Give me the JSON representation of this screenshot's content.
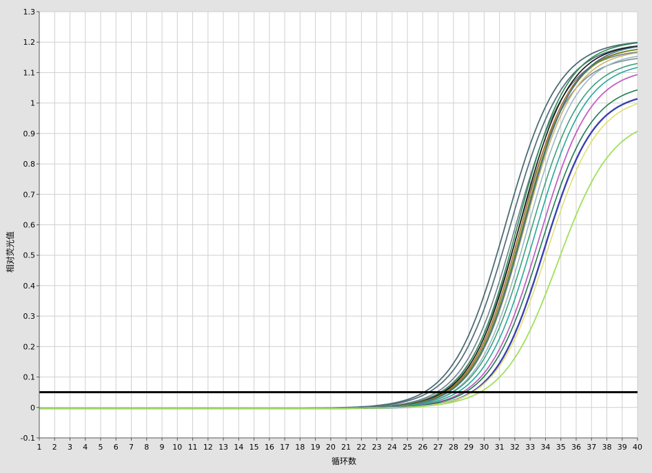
{
  "chart_data": {
    "type": "line",
    "title": "",
    "xlabel": "循环数",
    "ylabel": "相对荧光值",
    "xlim": [
      1,
      40
    ],
    "ylim": [
      -0.1,
      1.3
    ],
    "grid": true,
    "legend": "none",
    "x_ticks": [
      1,
      2,
      3,
      4,
      5,
      6,
      7,
      8,
      9,
      10,
      11,
      12,
      13,
      14,
      15,
      16,
      17,
      18,
      19,
      20,
      21,
      22,
      23,
      24,
      25,
      26,
      27,
      28,
      29,
      30,
      31,
      32,
      33,
      34,
      35,
      36,
      37,
      38,
      39,
      40
    ],
    "y_ticks": [
      -0.1,
      0,
      0.1,
      0.2,
      0.3,
      0.4,
      0.5,
      0.6,
      0.7,
      0.8,
      0.9,
      1,
      1.1,
      1.2,
      1.3
    ],
    "y_tick_labels": [
      "-0.1",
      "0",
      "0.1",
      "0.2",
      "0.3",
      "0.4",
      "0.5",
      "0.6",
      "0.7",
      "0.8",
      "0.9",
      "1",
      "1.1",
      "1.2",
      "1.3"
    ],
    "threshold": 0.05,
    "threshold_color": "#000000",
    "baseline": -0.003,
    "plot_background": "#ffffff",
    "grid_color": "#cfcfcf",
    "series": [
      {
        "color": "#4a6a72",
        "width": 1.8,
        "plateau": 1.21,
        "midpoint": 31.4,
        "slope": 0.58
      },
      {
        "color": "#55707a",
        "width": 1.8,
        "plateau": 1.2,
        "midpoint": 31.7,
        "slope": 0.58
      },
      {
        "color": "#6a8088",
        "width": 1.6,
        "plateau": 1.18,
        "midpoint": 32.0,
        "slope": 0.6
      },
      {
        "color": "#7a8e96",
        "width": 1.6,
        "plateau": 1.16,
        "midpoint": 32.2,
        "slope": 0.6
      },
      {
        "color": "#2e8b57",
        "width": 1.6,
        "plateau": 1.21,
        "midpoint": 32.2,
        "slope": 0.62
      },
      {
        "color": "#111111",
        "width": 1.6,
        "plateau": 1.2,
        "midpoint": 32.3,
        "slope": 0.62
      },
      {
        "color": "#b06a2a",
        "width": 1.6,
        "plateau": 1.19,
        "midpoint": 32.4,
        "slope": 0.62
      },
      {
        "color": "#6b8e23",
        "width": 1.6,
        "plateau": 1.19,
        "midpoint": 32.5,
        "slope": 0.62
      },
      {
        "color": "#c9b46a",
        "width": 1.6,
        "plateau": 1.18,
        "midpoint": 32.6,
        "slope": 0.62
      },
      {
        "color": "#3c6e8f",
        "width": 1.6,
        "plateau": 1.2,
        "midpoint": 32.6,
        "slope": 0.62
      },
      {
        "color": "#9db7c4",
        "width": 1.6,
        "plateau": 1.17,
        "midpoint": 32.8,
        "slope": 0.62
      },
      {
        "color": "#3aa07a",
        "width": 1.6,
        "plateau": 1.15,
        "midpoint": 33.0,
        "slope": 0.6
      },
      {
        "color": "#26a69a",
        "width": 1.6,
        "plateau": 1.14,
        "midpoint": 33.3,
        "slope": 0.6
      },
      {
        "color": "#c060c0",
        "width": 1.8,
        "plateau": 1.12,
        "midpoint": 33.6,
        "slope": 0.6
      },
      {
        "color": "#1e7a4e",
        "width": 1.6,
        "plateau": 1.07,
        "midpoint": 33.7,
        "slope": 0.6
      },
      {
        "color": "#3b3fb0",
        "width": 2.4,
        "plateau": 1.04,
        "midpoint": 33.9,
        "slope": 0.62
      },
      {
        "color": "#e0e070",
        "width": 1.6,
        "plateau": 1.03,
        "midpoint": 34.1,
        "slope": 0.6
      },
      {
        "color": "#9ee05a",
        "width": 1.8,
        "plateau": 0.96,
        "midpoint": 34.8,
        "slope": 0.56
      }
    ]
  }
}
